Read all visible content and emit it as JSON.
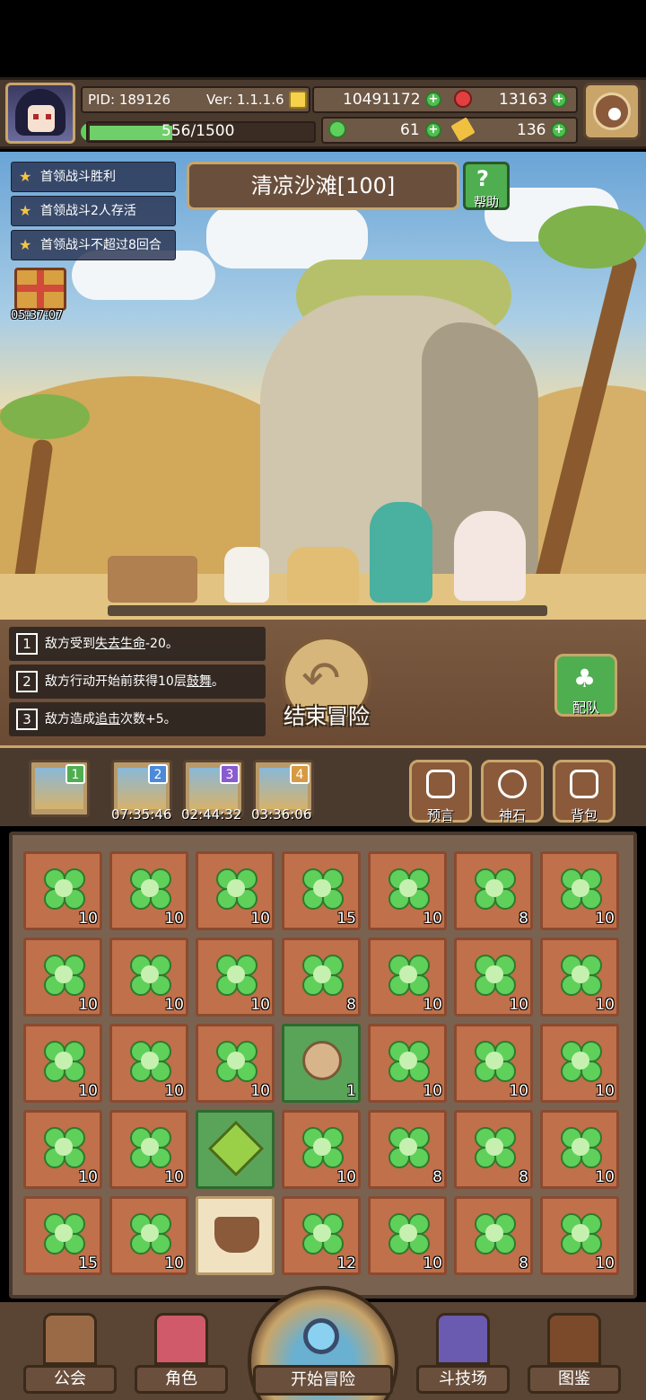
{
  "header": {
    "pid": "PID: 189126",
    "version": "Ver: 1.1.1.6",
    "gold": "10491172",
    "gems": "13163",
    "energy": "556/1500",
    "energy_fraction": 0.37,
    "clover": "61",
    "tickets": "136"
  },
  "quests": [
    "首领战斗胜利",
    "首领战斗2人存活",
    "首领战斗不超过8回合"
  ],
  "gift_timer": "05:37:07",
  "stage_title": "清凉沙滩[100]",
  "help_label": "帮助",
  "buffs": [
    {
      "num": "1",
      "pre": "敌方受到",
      "key": "失去生命",
      "post": "-20。"
    },
    {
      "num": "2",
      "pre": "敌方行动开始前获得10层",
      "key": "鼓舞",
      "post": "。"
    },
    {
      "num": "3",
      "pre": "敌方造成",
      "key": "追击",
      "post": "次数+5。"
    }
  ],
  "end_adventure_label": "结束冒险",
  "team_label": "配队",
  "slots": [
    {
      "badge": "1",
      "badge_color": "#4fae4f",
      "timer": ""
    },
    {
      "badge": "2",
      "badge_color": "#4a8ad8",
      "timer": "07:35:46"
    },
    {
      "badge": "3",
      "badge_color": "#8a5ad0",
      "timer": "02:44:32"
    },
    {
      "badge": "4",
      "badge_color": "#d89a40",
      "timer": "03:36:06"
    }
  ],
  "menu": {
    "prophecy": "预言",
    "godstone": "神石",
    "backpack": "背包"
  },
  "grid": [
    [
      "10",
      "10",
      "10",
      "15",
      "10",
      "8",
      "10"
    ],
    [
      "10",
      "10",
      "10",
      "8",
      "10",
      "10",
      "10"
    ],
    [
      "10",
      "10",
      "10",
      "1",
      "10",
      "10",
      "10"
    ],
    [
      "10",
      "10",
      "",
      "10",
      "8",
      "8",
      "10"
    ],
    [
      "15",
      "10",
      "",
      "12",
      "10",
      "8",
      "10"
    ]
  ],
  "nav": {
    "guild": "公会",
    "character": "角色",
    "start": "开始冒险",
    "arena": "斗技场",
    "codex": "图鉴"
  }
}
